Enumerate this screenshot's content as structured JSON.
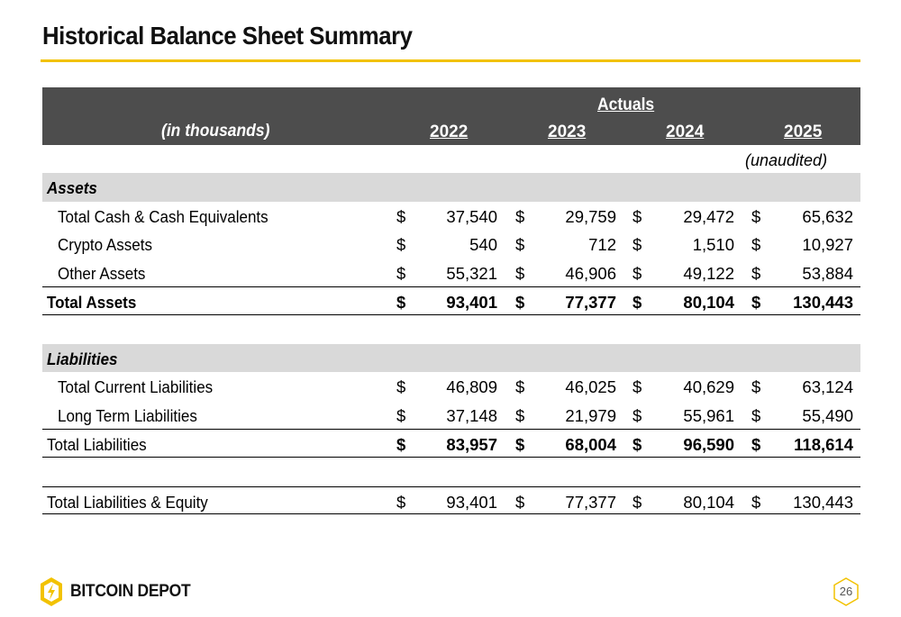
{
  "page": {
    "title": "Historical Balance Sheet Summary",
    "page_number": "26",
    "accent_color": "#f2c200"
  },
  "header": {
    "group_label": "Actuals",
    "units_label": "(in thousands)",
    "years": [
      "2022",
      "2023",
      "2024",
      "2025"
    ],
    "note_2025": "(unaudited)"
  },
  "currency_symbol": "$",
  "assets": {
    "section_label": "Assets",
    "rows": [
      {
        "label": "Total Cash & Cash Equivalents",
        "values": [
          "37,540",
          "29,759",
          "29,472",
          "65,632"
        ]
      },
      {
        "label": "Crypto Assets",
        "values": [
          "540",
          "712",
          "1,510",
          "10,927"
        ]
      },
      {
        "label": "Other Assets",
        "values": [
          "55,321",
          "46,906",
          "49,122",
          "53,884"
        ]
      }
    ],
    "total": {
      "label": "Total Assets",
      "values": [
        "93,401",
        "77,377",
        "80,104",
        "130,443"
      ]
    }
  },
  "liabilities": {
    "section_label": "Liabilities",
    "rows": [
      {
        "label": "Total Current Liabilities",
        "values": [
          "46,809",
          "46,025",
          "40,629",
          "63,124"
        ]
      },
      {
        "label": "Long Term Liabilities",
        "values": [
          "37,148",
          "21,979",
          "55,961",
          "55,490"
        ]
      }
    ],
    "total": {
      "label": "Total Liabilities",
      "values": [
        "83,957",
        "68,004",
        "96,590",
        "118,614"
      ]
    }
  },
  "liabilities_equity": {
    "label": "Total Liabilities & Equity",
    "values": [
      "93,401",
      "77,377",
      "80,104",
      "130,443"
    ]
  },
  "brand": {
    "name": "BITCOIN DEPOT",
    "logo_icon": "bitcoin-depot-logo-icon"
  }
}
